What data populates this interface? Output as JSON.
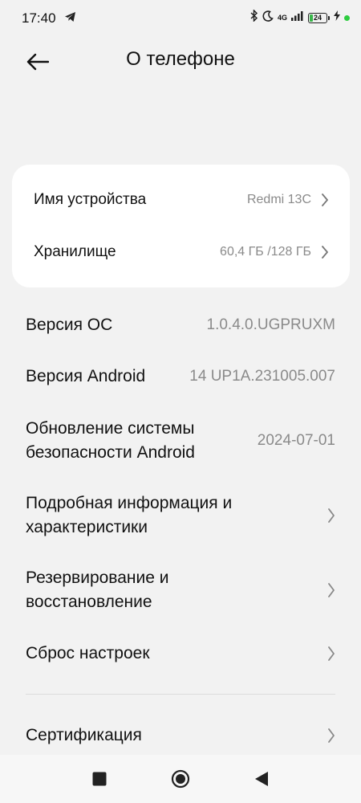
{
  "status_bar": {
    "time": "17:40",
    "network": "4G",
    "network_sub": "4G",
    "battery_level": "24",
    "icons": [
      "telegram-icon",
      "bluetooth-icon",
      "moon-icon",
      "signal-icon",
      "battery-icon",
      "charging-icon",
      "green-dot-icon"
    ]
  },
  "header": {
    "title": "О телефоне",
    "back_icon": "arrow-left-icon"
  },
  "card": {
    "device_name_label": "Имя устройства",
    "device_name_value": "Redmi 13C",
    "storage_label": "Хранилище",
    "storage_value": "60,4 ГБ /128 ГБ"
  },
  "list": {
    "os_version_label": "Версия ОС",
    "os_version_value": "1.0.4.0.UGPRUXM",
    "android_version_label": "Версия Android",
    "android_version_value": "14 UP1A.231005.007",
    "security_update_label_1": "Обновление системы",
    "security_update_label_2": "безопасности Android",
    "security_update_value": "2024-07-01",
    "details_label_1": "Подробная информация и",
    "details_label_2": "характеристики",
    "backup_label_1": "Резервирование и",
    "backup_label_2": "восстановление",
    "reset_label": "Сброс настроек",
    "certification_label": "Сертификация"
  },
  "nav_bar": {
    "icons": [
      "recents-square-icon",
      "home-circle-icon",
      "back-triangle-icon"
    ]
  },
  "colors": {
    "background": "#f2f2f2",
    "card": "#ffffff",
    "secondary_text": "#8a8a8a",
    "battery_green": "#3ab54a"
  }
}
